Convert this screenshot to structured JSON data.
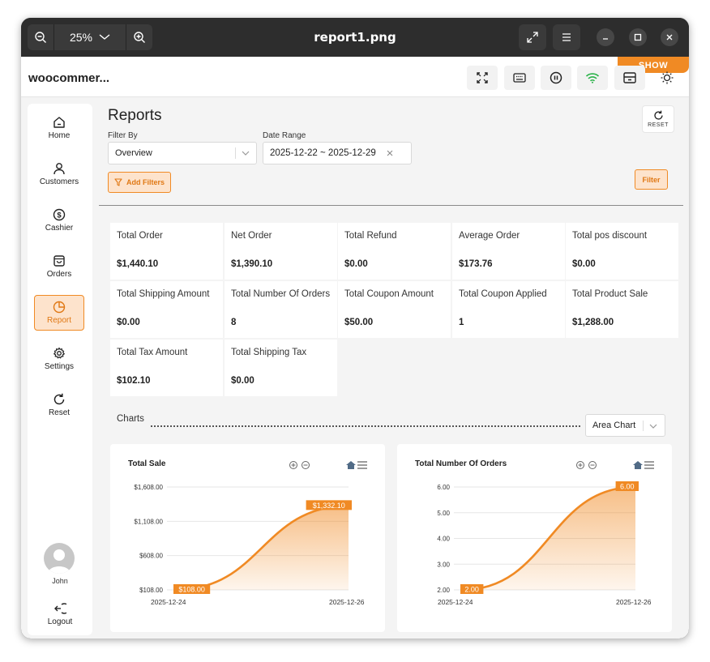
{
  "window": {
    "zoom": "25%",
    "title": "report1.png"
  },
  "topbar": {
    "brand": "woocommer...",
    "show_label": "SHOW"
  },
  "sidebar": {
    "items": [
      {
        "label": "Home",
        "icon": "home-icon"
      },
      {
        "label": "Customers",
        "icon": "person-icon"
      },
      {
        "label": "Cashier",
        "icon": "dollar-icon"
      },
      {
        "label": "Orders",
        "icon": "bag-icon"
      },
      {
        "label": "Report",
        "icon": "pie-chart-icon"
      },
      {
        "label": "Settings",
        "icon": "gear-icon"
      },
      {
        "label": "Reset",
        "icon": "refresh-icon"
      }
    ],
    "active": "Report",
    "user": "John",
    "logout": "Logout"
  },
  "reports": {
    "heading": "Reports",
    "reset": "RESET",
    "filter_by_label": "Filter By",
    "filter_by_value": "Overview",
    "date_range_label": "Date Range",
    "date_range_value": "2025-12-22 ~ 2025-12-29",
    "add_filters": "Add Filters",
    "filter": "Filter"
  },
  "stats": [
    {
      "label": "Total Order",
      "value": "$1,440.10"
    },
    {
      "label": "Net Order",
      "value": "$1,390.10"
    },
    {
      "label": "Total Refund",
      "value": "$0.00"
    },
    {
      "label": "Average Order",
      "value": "$173.76"
    },
    {
      "label": "Total pos discount",
      "value": "$0.00"
    },
    {
      "label": "Total Shipping Amount",
      "value": "$0.00"
    },
    {
      "label": "Total Number Of Orders",
      "value": "8"
    },
    {
      "label": "Total Coupon Amount",
      "value": "$50.00"
    },
    {
      "label": "Total Coupon Applied",
      "value": "1"
    },
    {
      "label": "Total Product Sale",
      "value": "$1,288.00"
    },
    {
      "label": "Total Tax Amount",
      "value": "$102.10"
    },
    {
      "label": "Total Shipping Tax",
      "value": "$0.00"
    }
  ],
  "charts_section": {
    "label": "Charts",
    "chart_type": "Area Chart"
  },
  "colors": {
    "accent": "#f08a24",
    "accent_light": "#fde3cc"
  },
  "chart_data": [
    {
      "type": "area",
      "title": "Total Sale",
      "x": [
        "2025-12-24",
        "2025-12-26"
      ],
      "series": [
        {
          "values": [
            108.0,
            1332.1
          ]
        }
      ],
      "ylim": [
        108,
        1608
      ],
      "yticks": [
        "$1,608.00",
        "$1,108.00",
        "$608.00",
        "$108.00"
      ],
      "data_labels": [
        "$108.00",
        "$1,332.10"
      ],
      "grid": true,
      "legend": "none"
    },
    {
      "type": "area",
      "title": "Total Number Of Orders",
      "x": [
        "2025-12-24",
        "2025-12-26"
      ],
      "series": [
        {
          "values": [
            2.0,
            6.0
          ]
        }
      ],
      "ylim": [
        2,
        6
      ],
      "yticks": [
        "6.00",
        "5.00",
        "4.00",
        "3.00",
        "2.00"
      ],
      "data_labels": [
        "2.00",
        "6.00"
      ],
      "grid": true,
      "legend": "none"
    }
  ]
}
